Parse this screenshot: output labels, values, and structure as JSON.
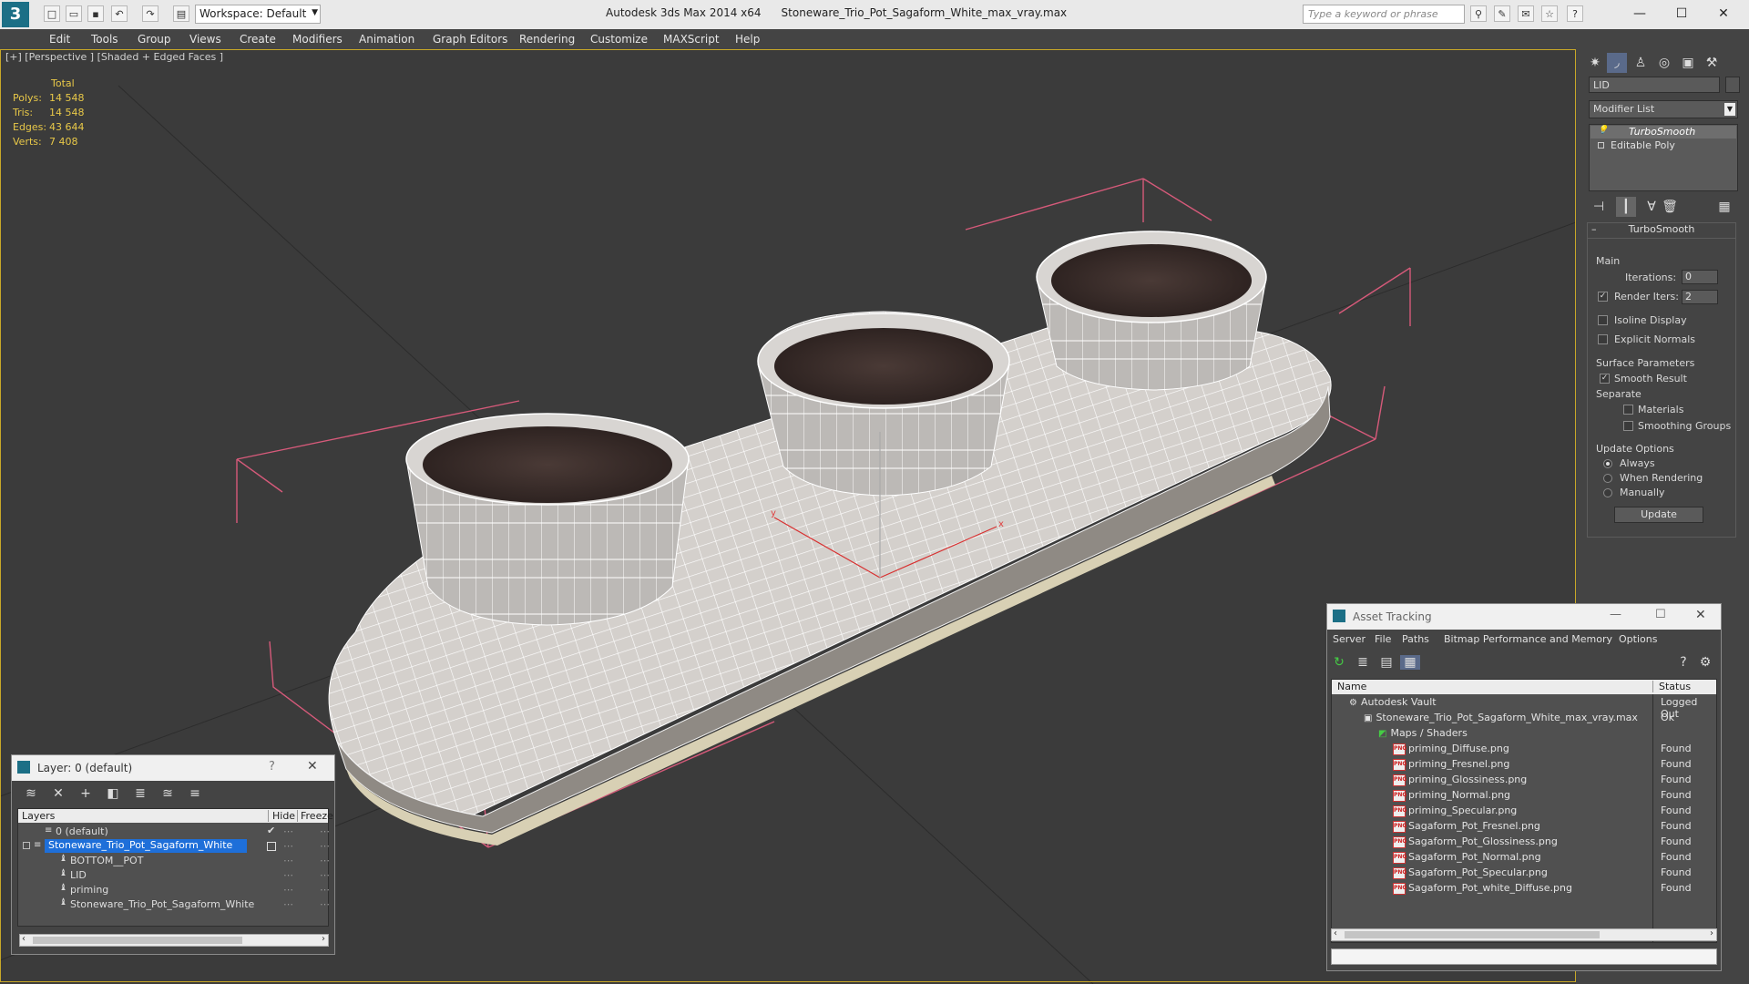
{
  "app": {
    "name": "Autodesk 3ds Max  2014 x64",
    "file": "Stoneware_Trio_Pot_Sagaform_White_max_vray.max",
    "workspace": "Workspace: Default",
    "search_placeholder": "Type a keyword or phrase"
  },
  "menu": [
    "Edit",
    "Tools",
    "Group",
    "Views",
    "Create",
    "Modifiers",
    "Animation",
    "Graph Editors",
    "Rendering",
    "Customize",
    "MAXScript",
    "Help"
  ],
  "viewport": {
    "label": "[+] [Perspective ] [Shaded + Edged Faces ]",
    "stats": {
      "header": "Total",
      "rows": [
        {
          "label": "Polys:",
          "value": "14 548"
        },
        {
          "label": "Tris:",
          "value": "14 548"
        },
        {
          "label": "Edges:",
          "value": "43 644"
        },
        {
          "label": "Verts:",
          "value": "7 408"
        }
      ]
    },
    "axis": {
      "x": "x",
      "y": "y"
    }
  },
  "command_panel": {
    "object_name": "LID",
    "modifier_list": "Modifier List",
    "stack": [
      "TurboSmooth",
      "Editable Poly"
    ],
    "rollout_title": "TurboSmooth",
    "main_label": "Main",
    "iterations_label": "Iterations:",
    "iterations_value": "0",
    "render_iters_label": "Render Iters:",
    "render_iters_value": "2",
    "isoline": "Isoline Display",
    "explicit_normals": "Explicit Normals",
    "surface_params": "Surface Parameters",
    "smooth_result": "Smooth Result",
    "separate": "Separate",
    "materials": "Materials",
    "smoothing_groups": "Smoothing Groups",
    "update_options": "Update Options",
    "always": "Always",
    "when_rendering": "When Rendering",
    "manually": "Manually",
    "update_btn": "Update"
  },
  "layer_window": {
    "title": "Layer: 0 (default)",
    "col_layers": "Layers",
    "col_hide": "Hide",
    "col_freeze": "Freeze",
    "rows": [
      {
        "name": "0 (default)"
      },
      {
        "name": "Stoneware_Trio_Pot_Sagaform_White"
      },
      {
        "name": "BOTTOM__POT"
      },
      {
        "name": "LID"
      },
      {
        "name": "priming"
      },
      {
        "name": "Stoneware_Trio_Pot_Sagaform_White"
      }
    ]
  },
  "asset_window": {
    "title": "Asset Tracking",
    "menu": [
      "Server",
      "File",
      "Paths",
      "Bitmap Performance and Memory",
      "Options"
    ],
    "col_name": "Name",
    "col_status": "Status",
    "rows": [
      {
        "name": "Autodesk Vault",
        "status": "Logged Out"
      },
      {
        "name": "Stoneware_Trio_Pot_Sagaform_White_max_vray.max",
        "status": "Ok"
      },
      {
        "name": "Maps / Shaders",
        "status": ""
      },
      {
        "name": "priming_Diffuse.png",
        "status": "Found"
      },
      {
        "name": "priming_Fresnel.png",
        "status": "Found"
      },
      {
        "name": "priming_Glossiness.png",
        "status": "Found"
      },
      {
        "name": "priming_Normal.png",
        "status": "Found"
      },
      {
        "name": "priming_Specular.png",
        "status": "Found"
      },
      {
        "name": "Sagaform_Pot_Fresnel.png",
        "status": "Found"
      },
      {
        "name": "Sagaform_Pot_Glossiness.png",
        "status": "Found"
      },
      {
        "name": "Sagaform_Pot_Normal.png",
        "status": "Found"
      },
      {
        "name": "Sagaform_Pot_Specular.png",
        "status": "Found"
      },
      {
        "name": "Sagaform_Pot_white_Diffuse.png",
        "status": "Found"
      }
    ]
  },
  "colors": {
    "selection": "#1e6fd9",
    "stats_text": "#e8c848",
    "viewport_bg": "#3b3b3b",
    "bbox_lines": "#d65a7a"
  }
}
